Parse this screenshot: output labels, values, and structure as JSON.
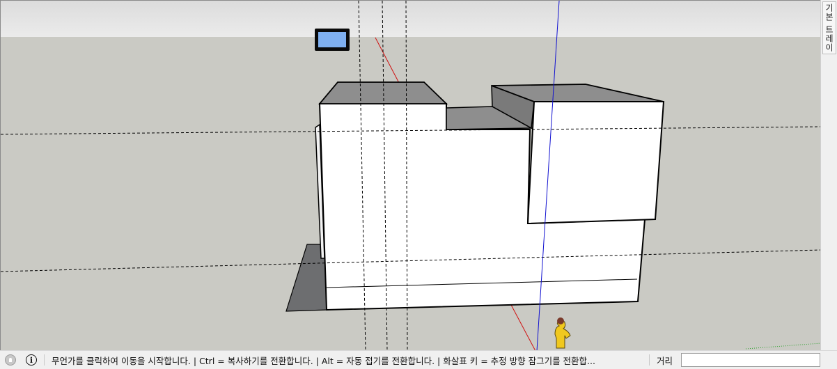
{
  "tray": {
    "tab_label": "기본 트레이"
  },
  "status": {
    "message": "무언가를 클릭하여 이동을 시작합니다. | Ctrl = 복사하기를 전환합니다. | Alt = 자동 접기를 전환합니다. | 화살표 키 = 추정 방향 잠그기를 전환합...",
    "distance_label": "거리",
    "distance_value": ""
  },
  "colors": {
    "sky": "#e6e7e6",
    "ground": "#cacac4",
    "face_white": "#ffffff",
    "roof_gray": "#8e8e8e",
    "shadow": "#6d6e70",
    "red_axis": "#d01010",
    "blue_axis": "#1010d0"
  },
  "icons": {
    "geo_location": "geo-location-icon",
    "instructor": "info-icon"
  }
}
